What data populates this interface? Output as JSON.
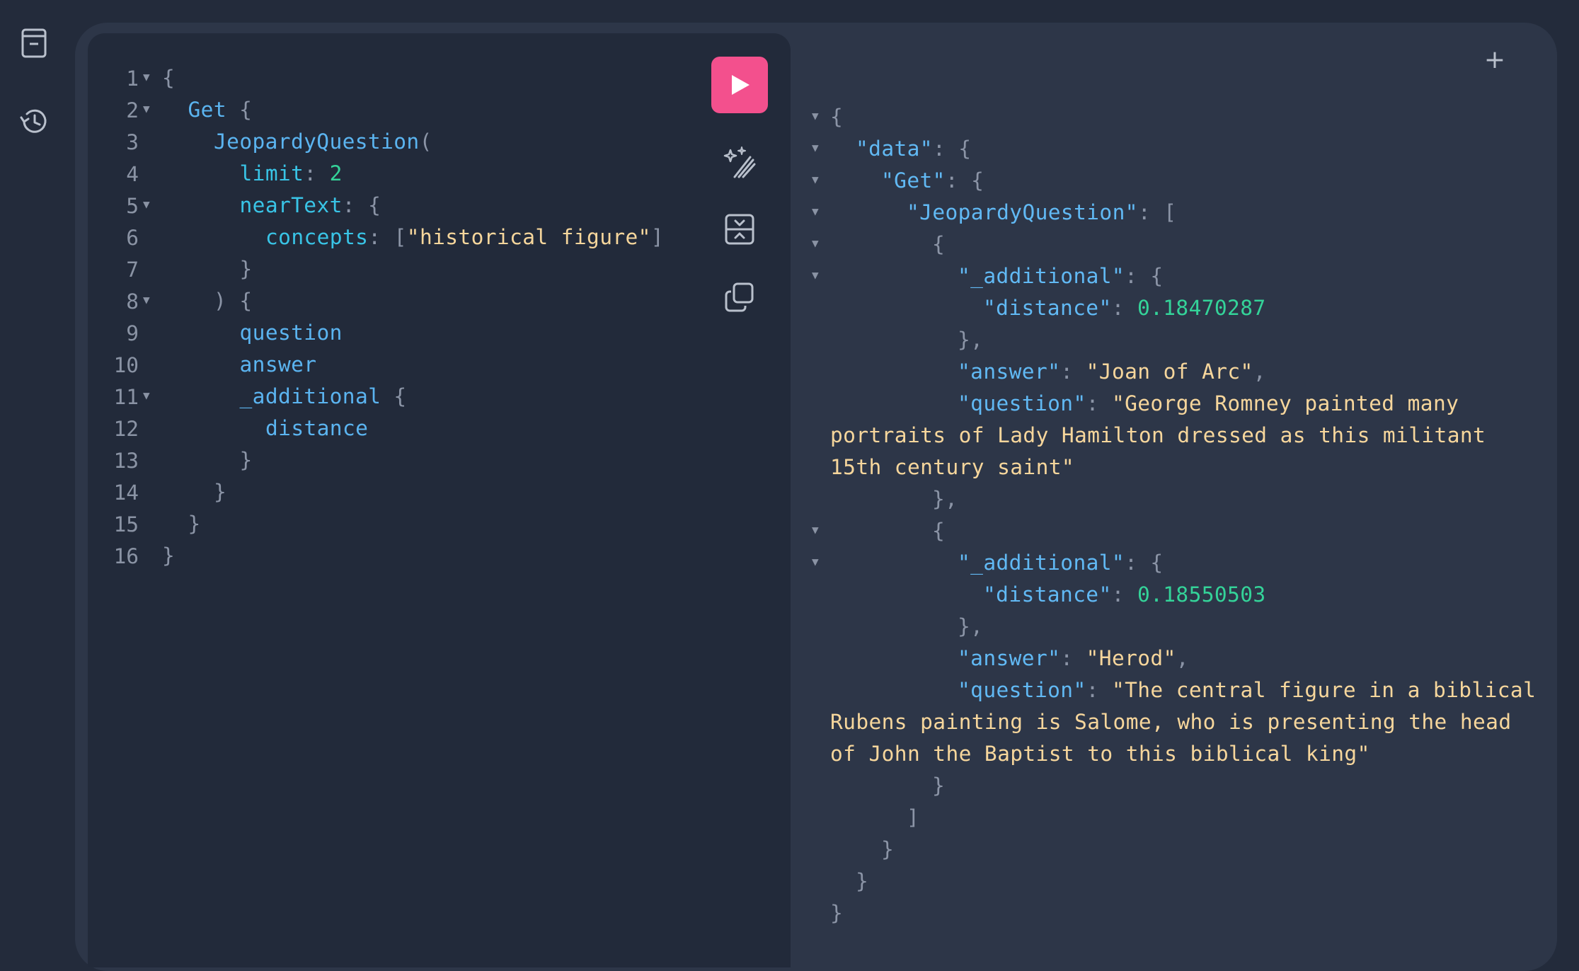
{
  "sidebar": {
    "icons": [
      "documentation-icon",
      "history-icon"
    ]
  },
  "editor": {
    "lines": [
      {
        "num": "1",
        "parts": [
          [
            "punct",
            "{"
          ]
        ]
      },
      {
        "num": "2",
        "parts": [
          [
            "field",
            "Get"
          ],
          [
            "punct",
            " {"
          ]
        ]
      },
      {
        "num": "3",
        "parts": [
          [
            "field",
            "JeopardyQuestion"
          ],
          [
            "punct",
            "("
          ]
        ]
      },
      {
        "num": "4",
        "parts": [
          [
            "prop",
            "limit"
          ],
          [
            "punct",
            ": "
          ],
          [
            "num",
            "2"
          ]
        ]
      },
      {
        "num": "5",
        "parts": [
          [
            "prop",
            "nearText"
          ],
          [
            "punct",
            ": {"
          ]
        ]
      },
      {
        "num": "6",
        "parts": [
          [
            "prop",
            "concepts"
          ],
          [
            "punct",
            ": ["
          ],
          [
            "str",
            "\"historical figure\""
          ],
          [
            "punct",
            "]"
          ]
        ]
      },
      {
        "num": "7",
        "parts": [
          [
            "punct",
            "}"
          ]
        ]
      },
      {
        "num": "8",
        "parts": [
          [
            "punct",
            ") {"
          ]
        ]
      },
      {
        "num": "9",
        "parts": [
          [
            "field",
            "question"
          ]
        ]
      },
      {
        "num": "10",
        "parts": [
          [
            "field",
            "answer"
          ]
        ]
      },
      {
        "num": "11",
        "parts": [
          [
            "field",
            "_additional"
          ],
          [
            "punct",
            " {"
          ]
        ]
      },
      {
        "num": "12",
        "parts": [
          [
            "field",
            "distance"
          ]
        ]
      },
      {
        "num": "13",
        "parts": [
          [
            "punct",
            "}"
          ]
        ]
      },
      {
        "num": "14",
        "parts": [
          [
            "punct",
            "}"
          ]
        ]
      },
      {
        "num": "15",
        "parts": [
          [
            "punct",
            "}"
          ]
        ]
      },
      {
        "num": "16",
        "parts": [
          [
            "punct",
            "}"
          ]
        ]
      }
    ]
  },
  "toolbar": {
    "run_icon": "play-icon",
    "prettify_icon": "magic-wand-icon",
    "merge_icon": "merge-fragments-icon",
    "copy_icon": "copy-icon"
  },
  "tabs": {
    "add_label": "+"
  },
  "result": {
    "lines": [
      {
        "parts": [
          [
            "punct",
            "{"
          ]
        ]
      },
      {
        "parts": [
          [
            "key",
            "\"data\""
          ],
          [
            "punct",
            ": {"
          ]
        ]
      },
      {
        "parts": [
          [
            "key",
            "\"Get\""
          ],
          [
            "punct",
            ": {"
          ]
        ]
      },
      {
        "parts": [
          [
            "key",
            "\"JeopardyQuestion\""
          ],
          [
            "punct",
            ": ["
          ]
        ]
      },
      {
        "parts": [
          [
            "punct",
            "{"
          ]
        ]
      },
      {
        "parts": [
          [
            "key",
            "\"_additional\""
          ],
          [
            "punct",
            ": {"
          ]
        ]
      },
      {
        "parts": [
          [
            "key",
            "\"distance\""
          ],
          [
            "punct",
            ": "
          ],
          [
            "num",
            "0.18470287"
          ]
        ]
      },
      {
        "parts": [
          [
            "punct",
            "},"
          ]
        ]
      },
      {
        "parts": [
          [
            "key",
            "\"answer\""
          ],
          [
            "punct",
            ": "
          ],
          [
            "str",
            "\"Joan of Arc\""
          ],
          [
            "punct",
            ","
          ]
        ]
      },
      {
        "parts": [
          [
            "key",
            "\"question\""
          ],
          [
            "punct",
            ": "
          ],
          [
            "str",
            "\"George Romney painted many"
          ]
        ]
      },
      {
        "parts": [
          [
            "str",
            "portraits of Lady Hamilton dressed as this militant"
          ]
        ]
      },
      {
        "parts": [
          [
            "str",
            "15th century saint\""
          ]
        ]
      },
      {
        "parts": [
          [
            "punct",
            "},"
          ]
        ]
      },
      {
        "parts": [
          [
            "punct",
            "{"
          ]
        ]
      },
      {
        "parts": [
          [
            "key",
            "\"_additional\""
          ],
          [
            "punct",
            ": {"
          ]
        ]
      },
      {
        "parts": [
          [
            "key",
            "\"distance\""
          ],
          [
            "punct",
            ": "
          ],
          [
            "num",
            "0.18550503"
          ]
        ]
      },
      {
        "parts": [
          [
            "punct",
            "},"
          ]
        ]
      },
      {
        "parts": [
          [
            "key",
            "\"answer\""
          ],
          [
            "punct",
            ": "
          ],
          [
            "str",
            "\"Herod\""
          ],
          [
            "punct",
            ","
          ]
        ]
      },
      {
        "parts": [
          [
            "key",
            "\"question\""
          ],
          [
            "punct",
            ": "
          ],
          [
            "str",
            "\"The central figure in a biblical"
          ]
        ]
      },
      {
        "parts": [
          [
            "str",
            "Rubens painting is Salome, who is presenting the head"
          ]
        ]
      },
      {
        "parts": [
          [
            "str",
            "of John the Baptist to this biblical king\""
          ]
        ]
      },
      {
        "parts": [
          [
            "punct",
            "}"
          ]
        ]
      },
      {
        "parts": [
          [
            "punct",
            "]"
          ]
        ]
      },
      {
        "parts": [
          [
            "punct",
            "}"
          ]
        ]
      },
      {
        "parts": [
          [
            "punct",
            "}"
          ]
        ]
      },
      {
        "parts": [
          [
            "punct",
            "}"
          ]
        ]
      }
    ]
  },
  "colors": {
    "accent": "#f3508d",
    "background": "#232b3b",
    "editor_bg": "#222a3a",
    "panel_bg": "#2d3648"
  }
}
